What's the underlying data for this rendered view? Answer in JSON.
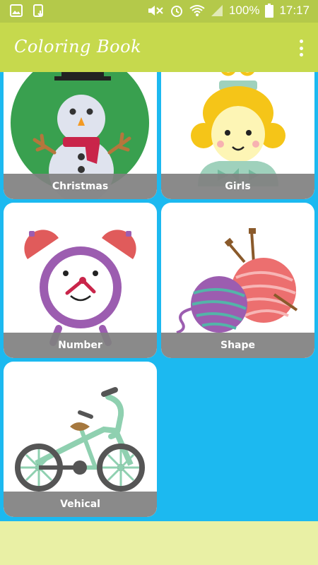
{
  "status_bar": {
    "battery_percent": "100%",
    "time": "17:17",
    "icons": [
      "image-icon",
      "download-icon",
      "mute-icon",
      "alarm-icon",
      "wifi-icon",
      "signal-icon",
      "battery-icon"
    ]
  },
  "app_bar": {
    "title": "Coloring Book",
    "menu_icon": "overflow-menu-icon"
  },
  "categories": [
    {
      "label": "Christmas",
      "icon": "snowman-icon"
    },
    {
      "label": "Girls",
      "icon": "princess-icon"
    },
    {
      "label": "Number",
      "icon": "alarm-clock-icon"
    },
    {
      "label": "Shape",
      "icon": "yarn-balls-icon"
    },
    {
      "label": "Vehical",
      "icon": "tricycle-icon"
    }
  ],
  "colors": {
    "status_bar": "#b4c94a",
    "app_bar": "#c6d94d",
    "grid_background": "#1cb9f0",
    "bottom_area": "#e9f0a5",
    "label_bar": "#808080"
  }
}
